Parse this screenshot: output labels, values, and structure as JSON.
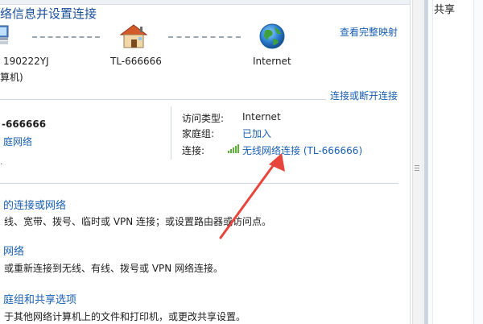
{
  "header": {
    "title": "络信息并设置连接",
    "view_full_map": "查看完整映射"
  },
  "network_map": {
    "computer_name": "190222YJ",
    "computer_sub": "算机)",
    "router_name": "TL-666666",
    "internet_label": "Internet"
  },
  "connect_disconnect": "连接或断开连接",
  "active_network": {
    "name": "-666666",
    "type": "庭网络",
    "access_type_label": "访问类型:",
    "access_type_value": "Internet",
    "homegroup_label": "家庭组:",
    "homegroup_value": "已加入",
    "connection_label": "连接:",
    "connection_value": "无线网络连接 (TL-666666)"
  },
  "tasks": [
    {
      "title": "的连接或网络",
      "desc": "线、宽带、拨号、临时或 VPN 连接；或设置路由器或访问点。"
    },
    {
      "title": "网络",
      "desc": "或重新连接到无线、有线、拨号或 VPN 网络连接。"
    },
    {
      "title": "庭组和共享选项",
      "desc": "于其他网络计算机上的文件和打印机，或更改共享设置。"
    }
  ],
  "side_panel": {
    "text": "共享"
  },
  "colors": {
    "link": "#1a5fb4",
    "arrow": "#e8453c",
    "signal": "#5db33a"
  }
}
